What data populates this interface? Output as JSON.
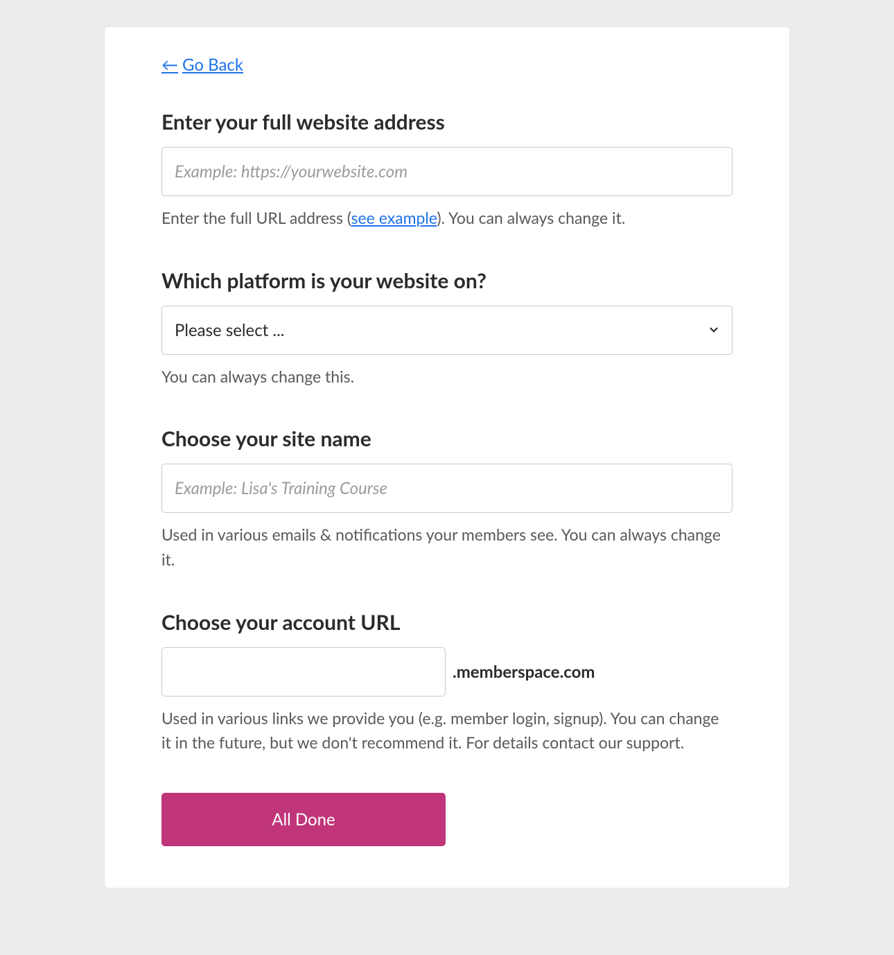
{
  "back": {
    "label": "Go Back"
  },
  "website": {
    "label": "Enter your full website address",
    "placeholder": "Example: https://yourwebsite.com",
    "help_prefix": "Enter the full URL address (",
    "help_link": "see example",
    "help_suffix": "). You can always change it."
  },
  "platform": {
    "label": "Which platform is your website on?",
    "selected": "Please select ...",
    "help": "You can always change this."
  },
  "sitename": {
    "label": "Choose your site name",
    "placeholder": "Example: Lisa's Training Course",
    "help": "Used in various emails & notifications your members see. You can always change it."
  },
  "accounturl": {
    "label": "Choose your account URL",
    "suffix": ".memberspace.com",
    "help": "Used in various links we provide you (e.g. member login, signup). You can change it in the future, but we don't recommend it. For details contact our support."
  },
  "submit": {
    "label": "All Done"
  }
}
